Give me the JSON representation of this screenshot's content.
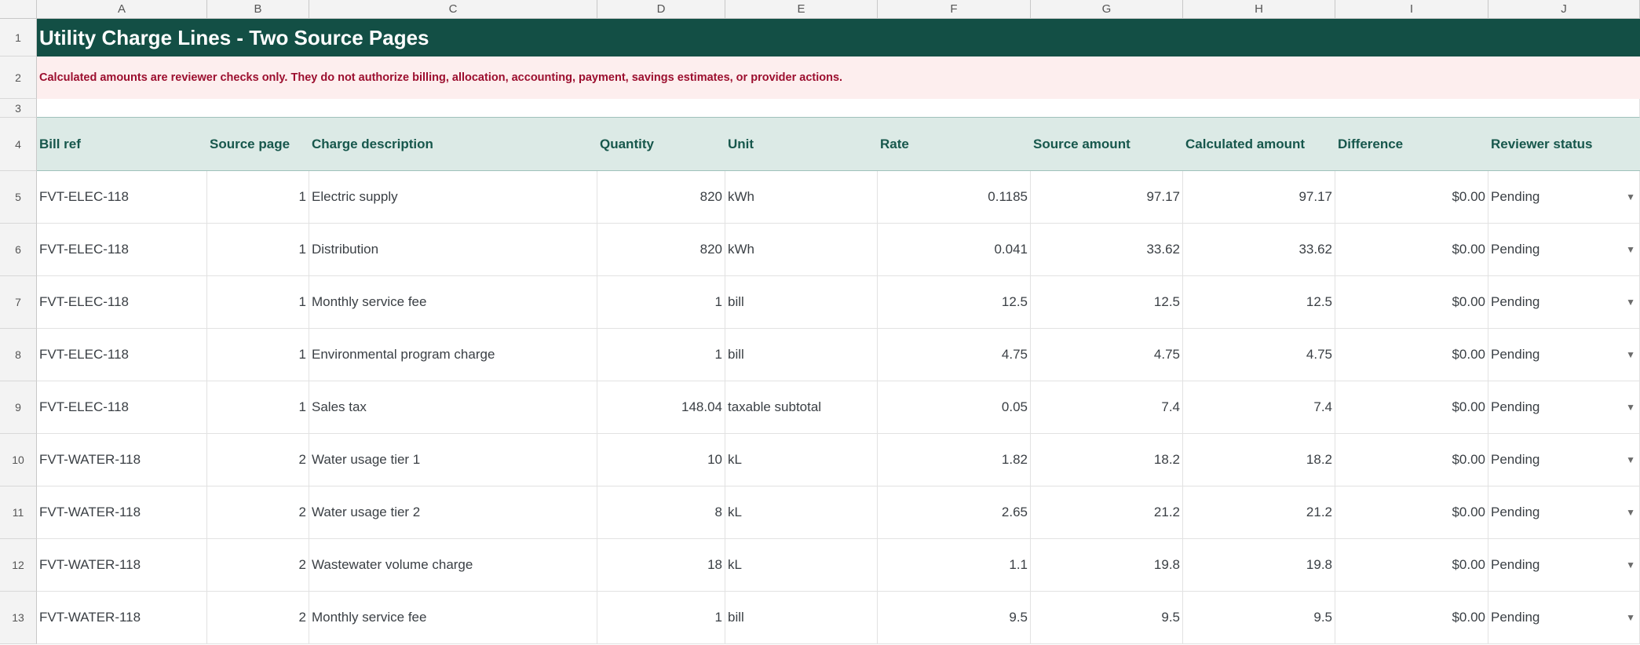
{
  "sheet": {
    "columns": [
      "A",
      "B",
      "C",
      "D",
      "E",
      "F",
      "G",
      "H",
      "I",
      "J"
    ],
    "title": "Utility Charge Lines - Two Source Pages",
    "notice": "Calculated amounts are reviewer checks only. They do not authorize billing, allocation, accounting, payment, savings estimates, or provider actions.",
    "row_numbers": [
      "1",
      "2",
      "3",
      "4",
      "5",
      "6",
      "7",
      "8",
      "9",
      "10",
      "11",
      "12",
      "13"
    ],
    "headers": [
      "Bill ref",
      "Source page",
      "Charge description",
      "Quantity",
      "Unit",
      "Rate",
      "Source amount",
      "Calculated amount",
      "Difference",
      "Reviewer status"
    ],
    "rows": [
      {
        "bill_ref": "FVT-ELEC-118",
        "source_page": "1",
        "description": "Electric supply",
        "quantity": "820",
        "unit": "kWh",
        "rate": "0.1185",
        "source_amount": "97.17",
        "calculated_amount": "97.17",
        "difference": "$0.00",
        "status": "Pending"
      },
      {
        "bill_ref": "FVT-ELEC-118",
        "source_page": "1",
        "description": "Distribution",
        "quantity": "820",
        "unit": "kWh",
        "rate": "0.041",
        "source_amount": "33.62",
        "calculated_amount": "33.62",
        "difference": "$0.00",
        "status": "Pending"
      },
      {
        "bill_ref": "FVT-ELEC-118",
        "source_page": "1",
        "description": "Monthly service fee",
        "quantity": "1",
        "unit": "bill",
        "rate": "12.5",
        "source_amount": "12.5",
        "calculated_amount": "12.5",
        "difference": "$0.00",
        "status": "Pending"
      },
      {
        "bill_ref": "FVT-ELEC-118",
        "source_page": "1",
        "description": "Environmental program charge",
        "quantity": "1",
        "unit": "bill",
        "rate": "4.75",
        "source_amount": "4.75",
        "calculated_amount": "4.75",
        "difference": "$0.00",
        "status": "Pending"
      },
      {
        "bill_ref": "FVT-ELEC-118",
        "source_page": "1",
        "description": "Sales tax",
        "quantity": "148.04",
        "unit": "taxable subtotal",
        "rate": "0.05",
        "source_amount": "7.4",
        "calculated_amount": "7.4",
        "difference": "$0.00",
        "status": "Pending"
      },
      {
        "bill_ref": "FVT-WATER-118",
        "source_page": "2",
        "description": "Water usage tier 1",
        "quantity": "10",
        "unit": "kL",
        "rate": "1.82",
        "source_amount": "18.2",
        "calculated_amount": "18.2",
        "difference": "$0.00",
        "status": "Pending"
      },
      {
        "bill_ref": "FVT-WATER-118",
        "source_page": "2",
        "description": "Water usage tier 2",
        "quantity": "8",
        "unit": "kL",
        "rate": "2.65",
        "source_amount": "21.2",
        "calculated_amount": "21.2",
        "difference": "$0.00",
        "status": "Pending"
      },
      {
        "bill_ref": "FVT-WATER-118",
        "source_page": "2",
        "description": "Wastewater volume charge",
        "quantity": "18",
        "unit": "kL",
        "rate": "1.1",
        "source_amount": "19.8",
        "calculated_amount": "19.8",
        "difference": "$0.00",
        "status": "Pending"
      },
      {
        "bill_ref": "FVT-WATER-118",
        "source_page": "2",
        "description": "Monthly service fee",
        "quantity": "1",
        "unit": "bill",
        "rate": "9.5",
        "source_amount": "9.5",
        "calculated_amount": "9.5",
        "difference": "$0.00",
        "status": "Pending"
      }
    ],
    "colors": {
      "title_bg": "#134f45",
      "notice_bg": "#fdeeee",
      "notice_text": "#9c0f2f",
      "header_bg": "#dceae6",
      "header_text": "#17574c"
    },
    "icons": {
      "status_dropdown": "caret-down-icon"
    }
  }
}
